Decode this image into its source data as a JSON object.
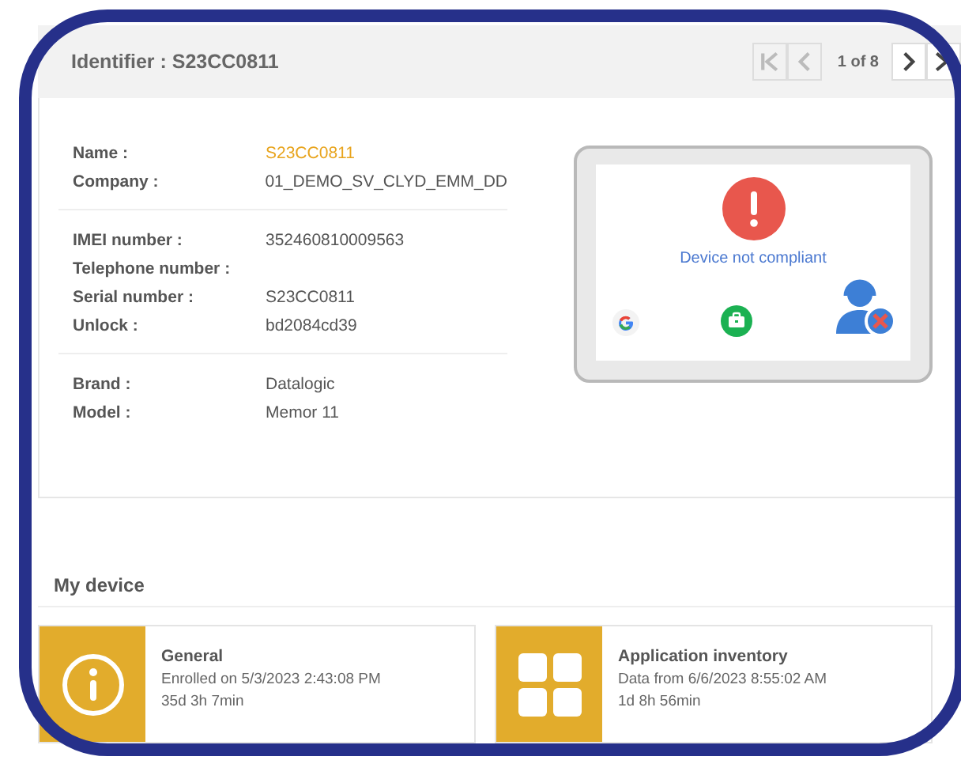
{
  "header": {
    "title": "Identifier : S23CC0811",
    "pager": {
      "label": "1 of 8",
      "buttons": [
        {
          "kind": "first",
          "disabled": true
        },
        {
          "kind": "prev",
          "disabled": true
        },
        {
          "kind": "next",
          "disabled": false
        },
        {
          "kind": "last",
          "disabled": false
        }
      ]
    }
  },
  "details": {
    "groups": [
      [
        {
          "label": "Name :",
          "value": "S23CC0811",
          "kind": "link"
        },
        {
          "label": "Company :",
          "value": "01_DEMO_SV_CLYD_EMM_DD",
          "kind": "text"
        }
      ],
      [
        {
          "label": "IMEI number :",
          "value": "352460810009563",
          "kind": "text"
        },
        {
          "label": "Telephone number :"
        },
        {
          "label": "Serial number :",
          "value": "S23CC0811",
          "kind": "text"
        },
        {
          "label": "Unlock :",
          "value": "bd2084cd39",
          "kind": "text"
        }
      ],
      [
        {
          "label": "Brand :",
          "value": "Datalogic",
          "kind": "text"
        },
        {
          "label": "Model :",
          "value": "Memor 11",
          "kind": "text"
        }
      ]
    ],
    "device_status": "Device not compliant"
  },
  "my_device": {
    "title": "My device",
    "cards": [
      {
        "kind": "info",
        "title": "General",
        "lines": [
          "Enrolled on 5/3/2023 2:43:08 PM",
          "35d 3h 7min"
        ]
      },
      {
        "kind": "apps",
        "title": "Application inventory",
        "lines": [
          "Data from 6/6/2023 8:55:02 AM",
          "1d 8h 56min"
        ]
      }
    ]
  }
}
